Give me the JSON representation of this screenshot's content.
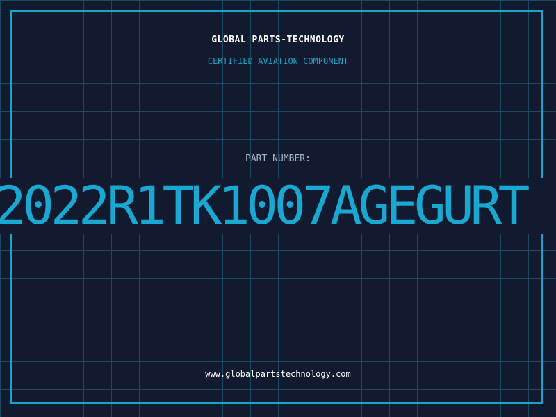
{
  "header": {
    "company": "GLOBAL PARTS-TECHNOLOGY",
    "tagline": "CERTIFIED AVIATION COMPONENT"
  },
  "part": {
    "label": "PART NUMBER:",
    "number": "2022R1TK1007AGEGURT"
  },
  "footer": {
    "website": "www.globalpartstechnology.com"
  },
  "colors": {
    "background": "#111a2e",
    "grid": "#1d4a63",
    "accent": "#1aa3c8",
    "text": "#ffffff",
    "label": "#a8b6c8"
  }
}
